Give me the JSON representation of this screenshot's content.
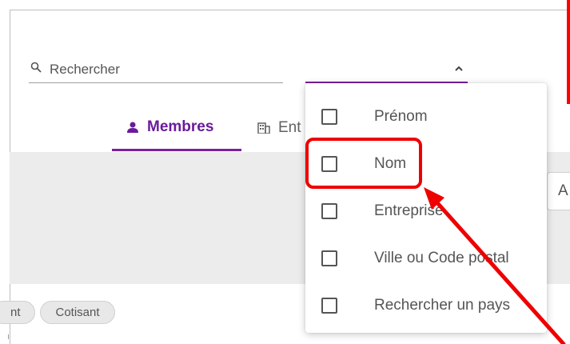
{
  "search": {
    "placeholder": "Rechercher",
    "value": ""
  },
  "filter": {
    "expanded": true
  },
  "tabs": [
    {
      "label": "Membres",
      "icon": "person-icon",
      "active": true
    },
    {
      "label": "Ent",
      "icon": "building-icon",
      "active": false
    }
  ],
  "add_button": {
    "label": "A"
  },
  "dropdown": {
    "options": [
      {
        "label": "Prénom",
        "checked": false
      },
      {
        "label": "Nom",
        "checked": false
      },
      {
        "label": "Entreprise",
        "checked": false
      },
      {
        "label": "Ville ou Code postal",
        "checked": false
      },
      {
        "label": "Rechercher un pays",
        "checked": false
      }
    ]
  },
  "chips": [
    {
      "label": "nt"
    },
    {
      "label": "Cotisant"
    }
  ],
  "colors": {
    "accent": "#7b1fa2",
    "annotation": "#ee0000",
    "band": "#ececec"
  }
}
